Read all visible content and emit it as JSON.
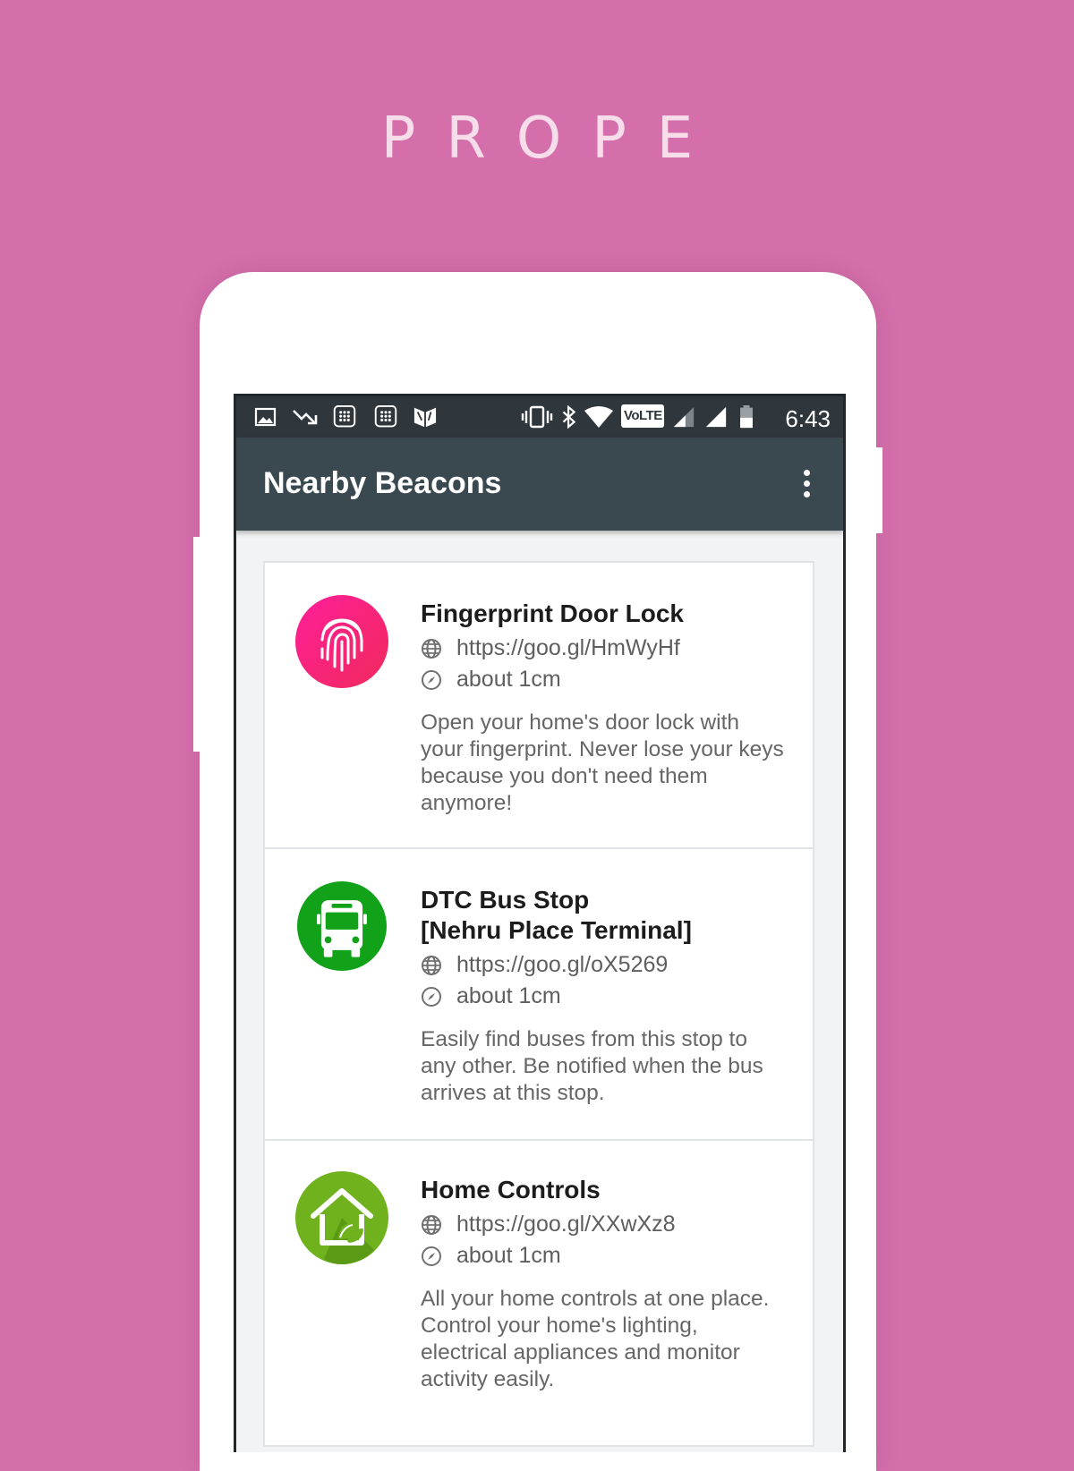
{
  "brand": "PROPE",
  "status_bar": {
    "time": "6:43",
    "left_icons": [
      "image-icon",
      "trending-down-icon",
      "dialpad-icon",
      "dialpad-icon",
      "book-icon"
    ],
    "right_icons": [
      "vibrate-icon",
      "bluetooth-icon",
      "wifi-icon",
      "volte-icon",
      "signal-icon",
      "signal-icon",
      "battery-icon"
    ],
    "volte_label": "VoLTE"
  },
  "app_bar": {
    "title": "Nearby Beacons",
    "menu_icon": "more-vert-icon"
  },
  "beacons": [
    {
      "title": "Fingerprint Door Lock",
      "url": "https://goo.gl/HmWyHf",
      "distance": "about 1cm",
      "description": "Open your home's door lock with your fingerprint. Never lose your keys because you don't need them anymore!",
      "icon": "fingerprint-icon",
      "icon_color": "#f0258a"
    },
    {
      "title": "DTC Bus Stop\n[Nehru Place Terminal]",
      "url": "https://goo.gl/oX5269",
      "distance": "about 1cm",
      "description": "Easily find buses from this stop to any other. Be notified when the bus arrives at this stop.",
      "icon": "bus-icon",
      "icon_color": "#12a21a"
    },
    {
      "title": "Home Controls",
      "url": "https://goo.gl/XXwXz8",
      "distance": "about 1cm",
      "description": "All your home controls at one place. Control your home's lighting, electrical appliances and monitor activity easily.",
      "icon": "eco-home-icon",
      "icon_color": "#6fb21e"
    }
  ],
  "colors": {
    "background": "#d46fab",
    "app_bar": "#3a4850",
    "status_bar": "#2f373d"
  }
}
